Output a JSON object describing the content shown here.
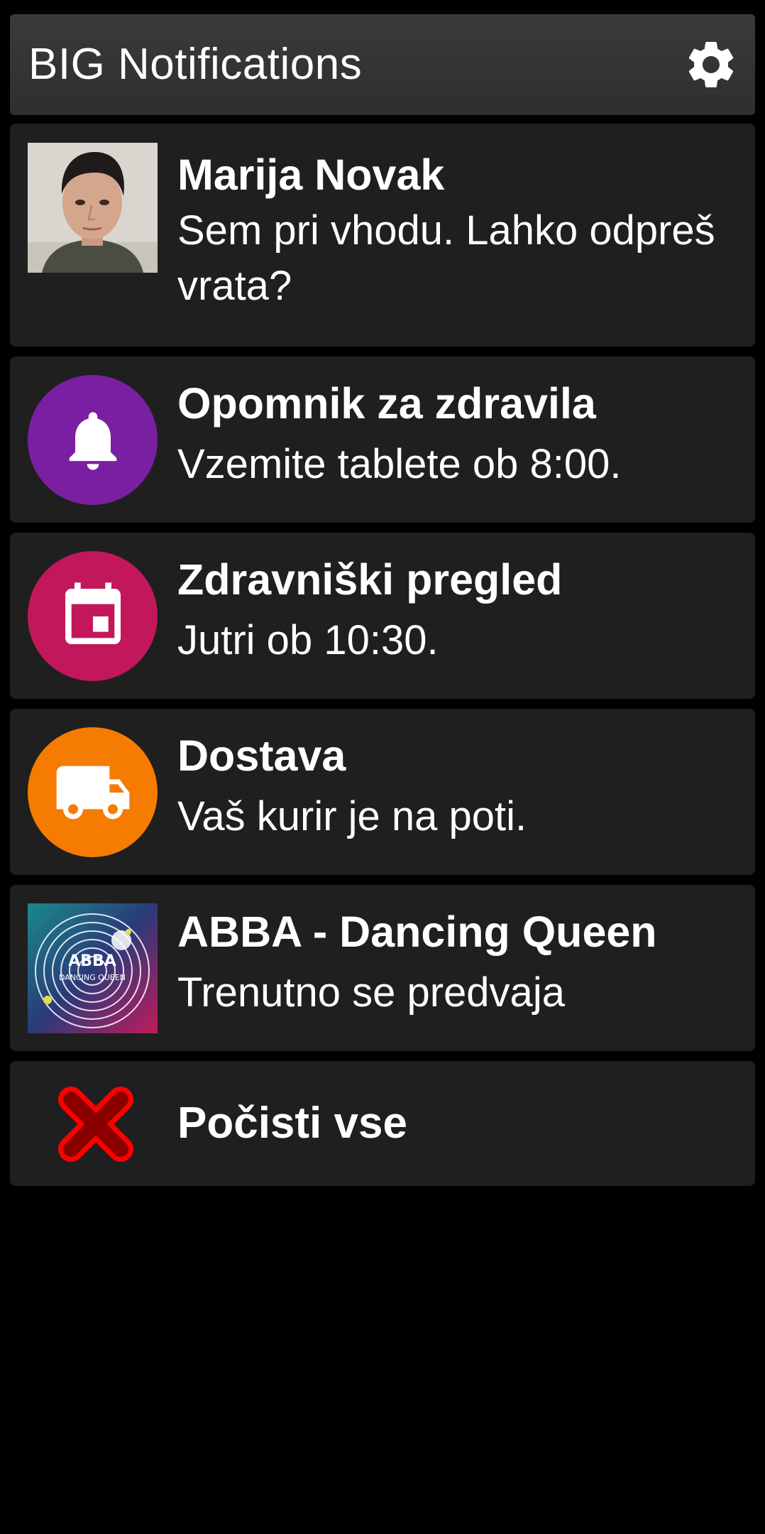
{
  "header": {
    "title": "BIG Notifications",
    "settings_icon": "gear-icon"
  },
  "notifications": [
    {
      "title": "Marija Novak",
      "body": "Sem pri vhodu. Lahko odpreš vrata?",
      "icon": "contact-photo"
    },
    {
      "title": "Opomnik za zdravila",
      "body": "Vzemite tablete ob 8:00.",
      "icon": "bell-icon",
      "color": "#7b1fa2"
    },
    {
      "title": "Zdravniški pregled",
      "body": "Jutri ob 10:30.",
      "icon": "calendar-icon",
      "color": "#c2185b"
    },
    {
      "title": "Dostava",
      "body": "Vaš kurir je na poti.",
      "icon": "truck-icon",
      "color": "#f57c00"
    },
    {
      "title": "ABBA - Dancing Queen",
      "body": "Trenutno se predvaja",
      "icon": "album-art",
      "album_art_text": [
        "ABBA",
        "DANCING QUEEN"
      ]
    }
  ],
  "clear_all": {
    "label": "Počisti vse",
    "icon": "close-icon",
    "color": "#e00000"
  }
}
